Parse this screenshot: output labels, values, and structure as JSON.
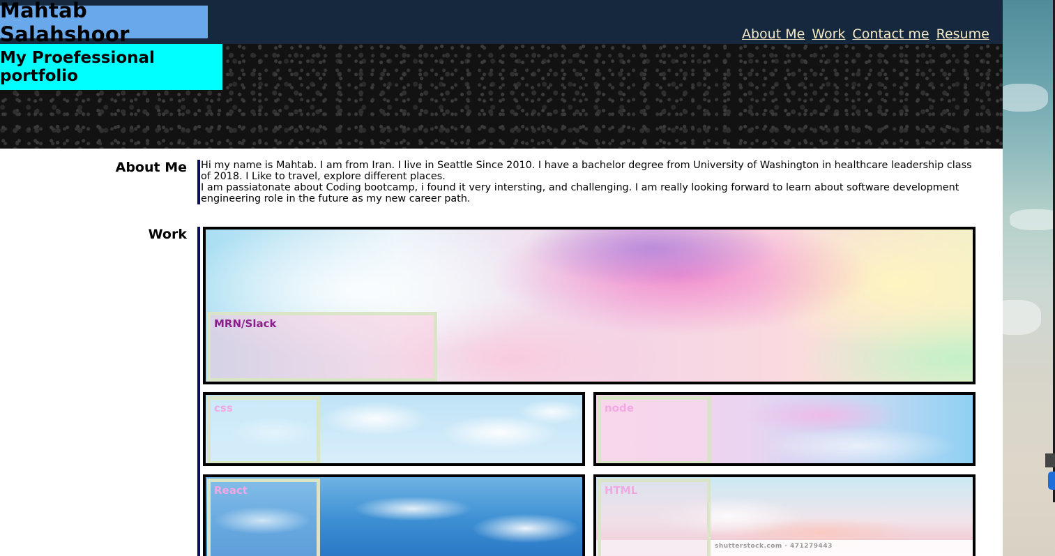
{
  "header": {
    "name": "Mahtab Salahshoor",
    "subtitle": "My Proefessional portfolio",
    "nav": [
      "About Me",
      "Work",
      "Contact me",
      "Resume"
    ]
  },
  "about": {
    "label": "About Me",
    "paragraph1": "Hi my name is Mahtab. I am from Iran. I live in Seattle Since 2010. I have a bachelor degree from University of Washington in healthcare leadership class of 2018. I Like to travel, explore different places.",
    "paragraph2": "I am passiatonate about Coding bootcamp, i found it very intersting, and challenging. I am really looking forward to learn about software development engineering role in the future as my new career path."
  },
  "work": {
    "label": "Work",
    "projects": [
      {
        "title": "MRN/Slack"
      },
      {
        "title": "css"
      },
      {
        "title": "node"
      },
      {
        "title": "React"
      },
      {
        "title": "HTML"
      }
    ],
    "watermark": "shutterstock.com · 471279443"
  },
  "colors": {
    "topbar": "#15283d",
    "name_box": "#6aa8ec",
    "subtitle_box": "#00ffff",
    "nav_link": "#f5e9c6",
    "section_border": "#0d0d5e"
  }
}
